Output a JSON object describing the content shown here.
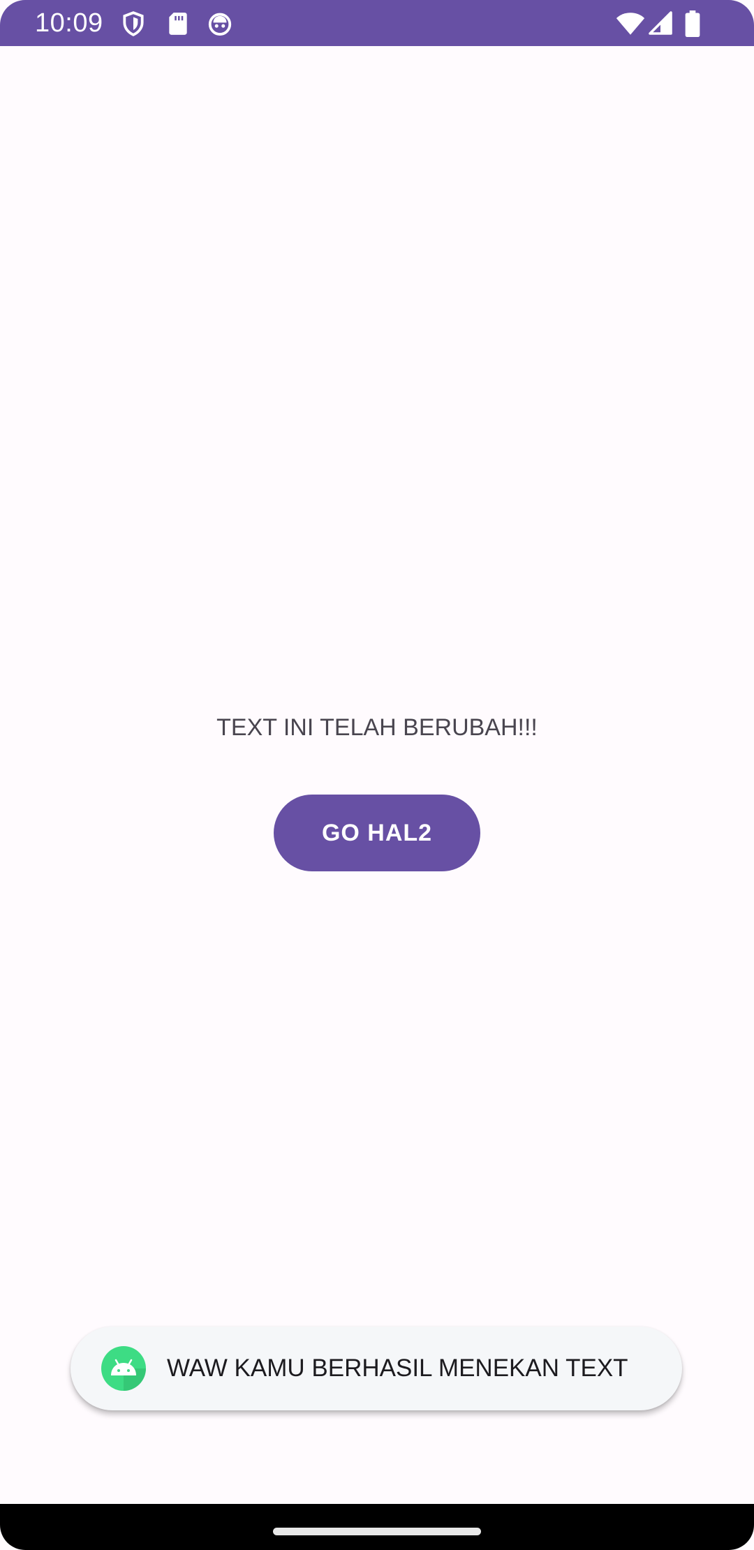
{
  "status_bar": {
    "time": "10:09",
    "background_color": "#6750A4",
    "left_icons": [
      "shield-icon",
      "sd-card-icon",
      "robot-face-icon"
    ],
    "right_icons": [
      "wifi-icon",
      "cellular-signal-icon",
      "battery-icon"
    ]
  },
  "main": {
    "text": "TEXT INI TELAH BERUBAH!!!",
    "button_label": "GO HAL2",
    "button_color": "#6750A4"
  },
  "toast": {
    "icon": "android-app-icon",
    "message": "WAW KAMU BERHASIL MENEKAN TEXT"
  },
  "nav_bar": {
    "handle": "home-gesture-handle"
  }
}
